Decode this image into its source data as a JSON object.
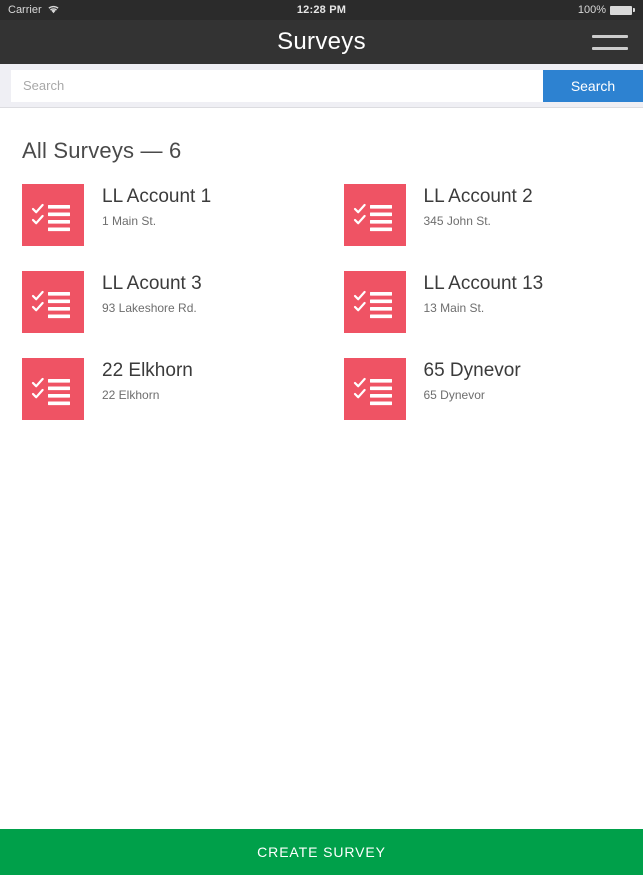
{
  "status_bar": {
    "carrier": "Carrier",
    "wifi_icon": "wifi-icon",
    "time": "12:28 PM",
    "battery_percent": "100%",
    "battery_icon": "battery-full-icon"
  },
  "header": {
    "title": "Surveys",
    "menu_icon": "hamburger-menu-icon"
  },
  "search": {
    "placeholder": "Search",
    "value": "",
    "button_label": "Search"
  },
  "main": {
    "section_title": "All Surveys — 6",
    "count": 6,
    "items": [
      {
        "name": "LL Account 1",
        "address": "1 Main St.",
        "icon": "checklist-icon"
      },
      {
        "name": "LL Account 2",
        "address": "345 John St.",
        "icon": "checklist-icon"
      },
      {
        "name": "LL Acount 3",
        "address": "93 Lakeshore Rd.",
        "icon": "checklist-icon"
      },
      {
        "name": "LL Account 13",
        "address": "13 Main St.",
        "icon": "checklist-icon"
      },
      {
        "name": "22 Elkhorn",
        "address": "22 Elkhorn",
        "icon": "checklist-icon"
      },
      {
        "name": "65 Dynevor",
        "address": "65 Dynevor",
        "icon": "checklist-icon"
      }
    ]
  },
  "footer": {
    "create_label": "CREATE SURVEY"
  },
  "colors": {
    "status_bar": "#2b2b2b",
    "header": "#333333",
    "search_bar_bg": "#efeff4",
    "search_button": "#2d82d1",
    "tile_pink": "#ef5364",
    "create_green": "#00a04a",
    "title_text": "#4a4a4a"
  }
}
